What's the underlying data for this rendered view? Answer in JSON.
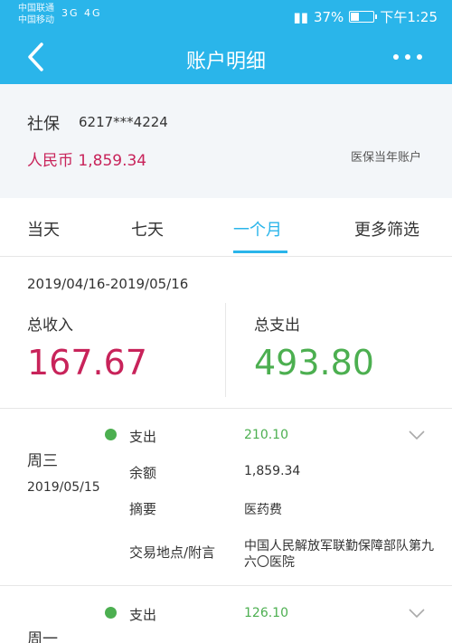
{
  "status": {
    "carrier1": "中国联通",
    "carrier2": "中国移动",
    "left_icons": "3G 4G",
    "battery": "37%",
    "time": "下午1:25"
  },
  "header": {
    "title": "账户明细"
  },
  "account": {
    "name": "社保",
    "number": "6217***4224",
    "balance": "人民币 1,859.34",
    "type": "医保当年账户"
  },
  "tabs": [
    {
      "label": "当天"
    },
    {
      "label": "七天"
    },
    {
      "label": "一个月"
    },
    {
      "label": "更多筛选"
    }
  ],
  "summary": {
    "range": "2019/04/16-2019/05/16",
    "income_label": "总收入",
    "income_value": "167.67",
    "expense_label": "总支出",
    "expense_value": "493.80"
  },
  "transactions": [
    {
      "weekday": "周三",
      "date": "2019/05/15",
      "type": "支出",
      "amount": "210.10",
      "balance_label": "余额",
      "balance": "1,859.34",
      "memo_label": "摘要",
      "memo": "医药费",
      "location_label": "交易地点/附言",
      "location_line1": "中国人民解放军联勤保障部队第九",
      "location_line2": "六〇医院"
    },
    {
      "weekday": "周一",
      "type": "支出",
      "amount": "126.10"
    }
  ],
  "colors": {
    "brand": "#2ab5ea",
    "income": "#c8235a",
    "expense": "#4caf50"
  }
}
